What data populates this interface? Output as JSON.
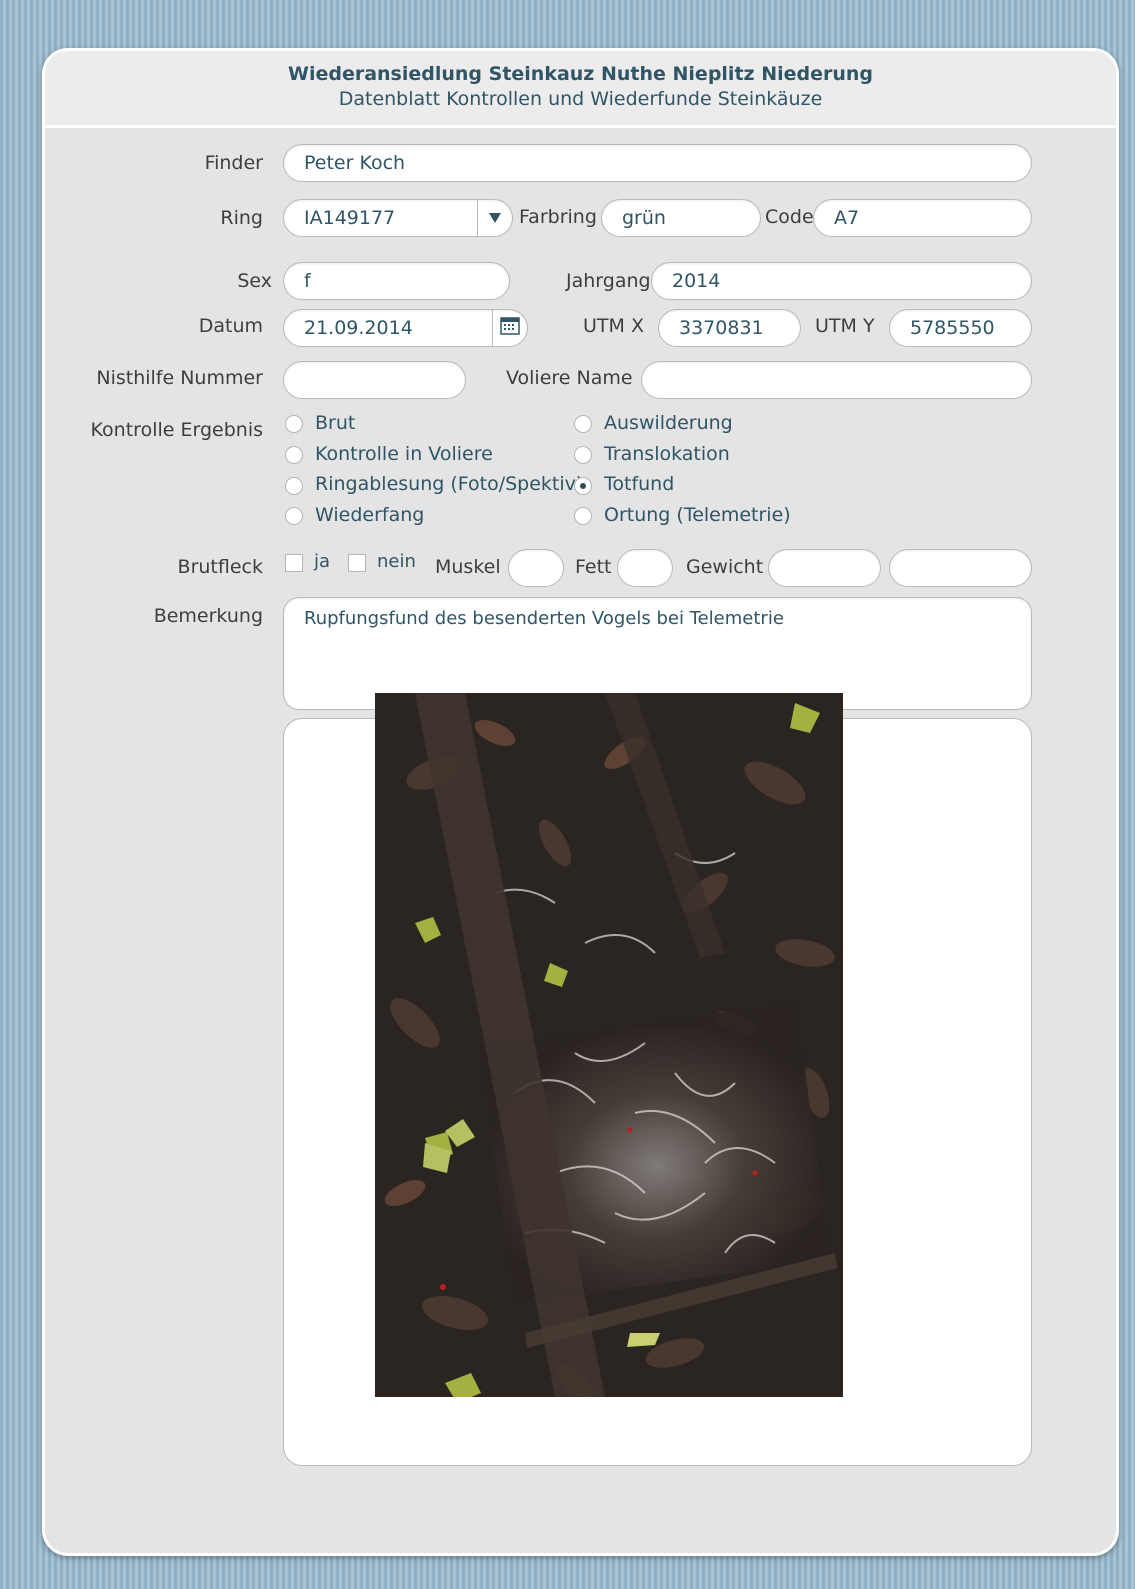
{
  "header": {
    "title": "Wiederansiedlung Steinkauz Nuthe Nieplitz Niederung",
    "subtitle": "Datenblatt Kontrollen und Wiederfunde Steinkäuze"
  },
  "labels": {
    "finder": "Finder",
    "ring": "Ring",
    "farbring": "Farbring",
    "code": "Code",
    "sex": "Sex",
    "jahrgang": "Jahrgang",
    "datum": "Datum",
    "utm_x": "UTM X",
    "utm_y": "UTM Y",
    "nisthilfe": "Nisthilfe Nummer",
    "voliere": "Voliere Name",
    "kontrolle": "Kontrolle Ergebnis",
    "brutfleck": "Brutfleck",
    "ja": "ja",
    "nein": "nein",
    "muskel": "Muskel",
    "fett": "Fett",
    "gewicht": "Gewicht",
    "bemerkung": "Bemerkung"
  },
  "values": {
    "finder": "Peter Koch",
    "ring": "IA149177",
    "farbring": "grün",
    "code": "A7",
    "sex": "f",
    "jahrgang": "2014",
    "datum": "21.09.2014",
    "utm_x": "3370831",
    "utm_y": "5785550",
    "nisthilfe": "",
    "voliere": "",
    "muskel": "",
    "fett": "",
    "gewicht": "",
    "gewicht2": "",
    "bemerkung": "Rupfungsfund des besenderten Vogels bei Telemetrie"
  },
  "kontrolle_options": [
    {
      "label": "Brut",
      "selected": false
    },
    {
      "label": "Kontrolle in Voliere",
      "selected": false
    },
    {
      "label": "Ringablesung (Foto/Spektiv)",
      "selected": false
    },
    {
      "label": "Wiederfang",
      "selected": false
    },
    {
      "label": "Auswilderung",
      "selected": false
    },
    {
      "label": "Translokation",
      "selected": false
    },
    {
      "label": "Totfund",
      "selected": true
    },
    {
      "label": "Ortung (Telemetrie)",
      "selected": false
    }
  ],
  "brutfleck": {
    "ja": false,
    "nein": false
  },
  "icons": {
    "ring_dropdown": "triangle-down-icon",
    "datum_picker": "calendar-icon"
  },
  "colors": {
    "text": "#2f5566",
    "label": "#3e3e3e",
    "background": "#e4e4e4"
  }
}
